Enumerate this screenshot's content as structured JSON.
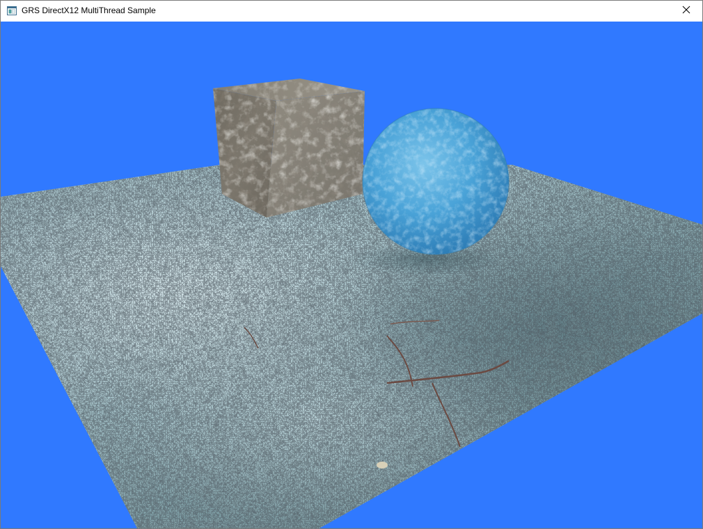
{
  "window": {
    "title": "GRS DirectX12 MultiThread Sample"
  },
  "icons": {
    "app": "application-window-icon",
    "close": "close-icon"
  },
  "scene": {
    "clear_color": "#3079ff",
    "objects": [
      "floor-plane",
      "stone-cube",
      "ice-sphere"
    ]
  },
  "colors": {
    "background": "#3079ff",
    "floor": "#8fb0b8",
    "cube": "#7a746a",
    "sphere": "#4aa6dc"
  }
}
